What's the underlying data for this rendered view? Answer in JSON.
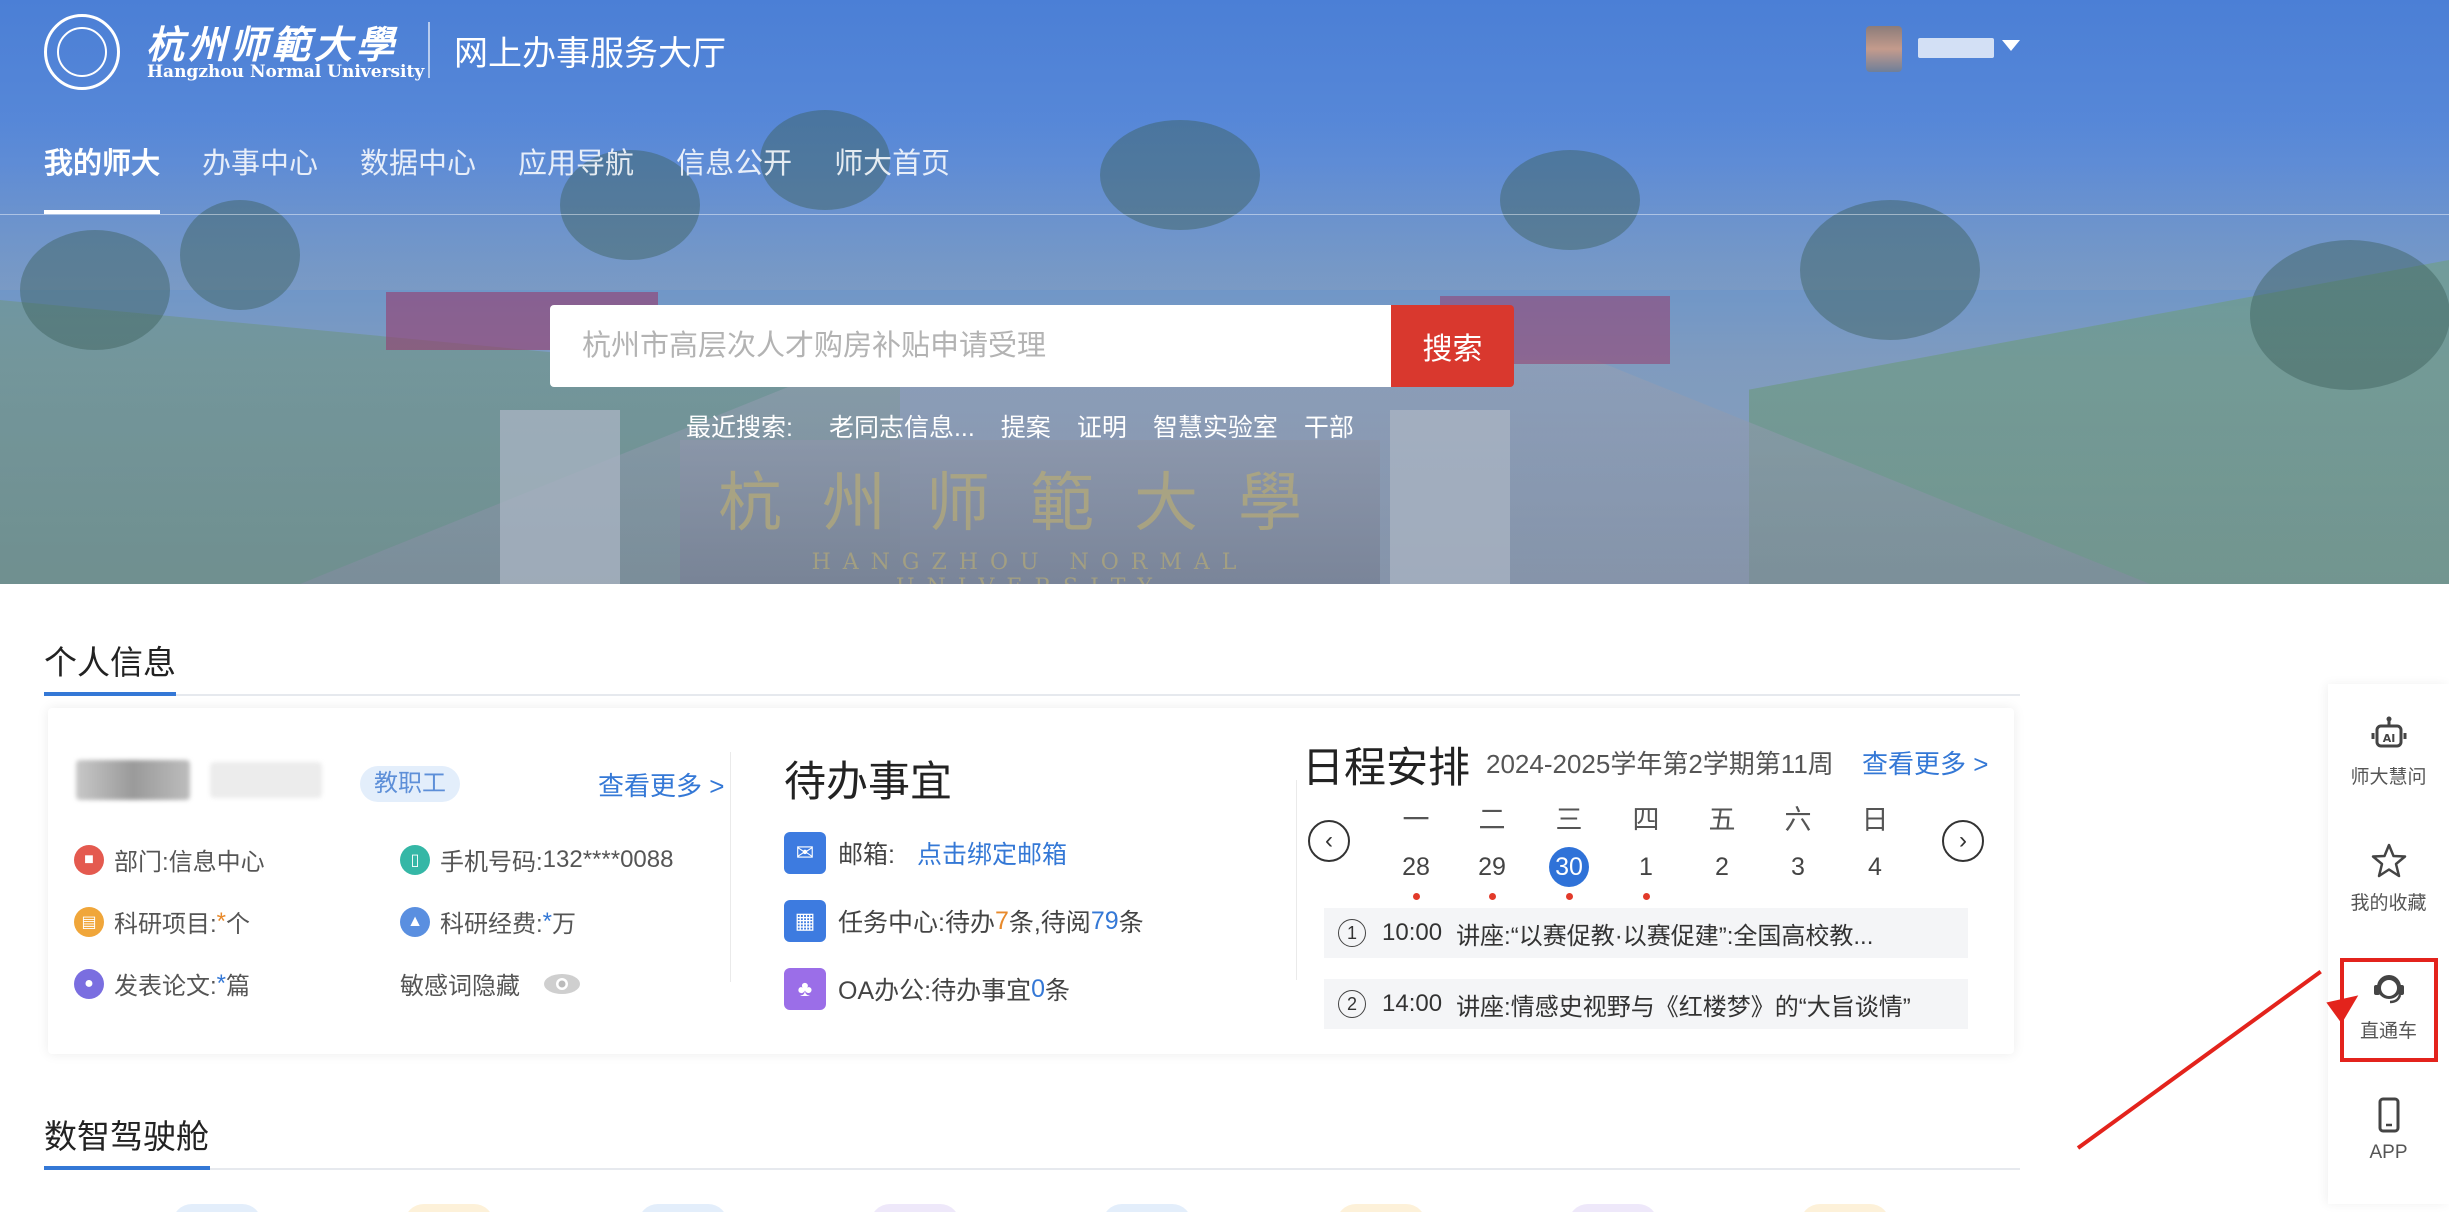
{
  "header": {
    "logo_cn": "杭州师範大學",
    "logo_en": "Hangzhou Normal University",
    "site_title": "网上办事服务大厅"
  },
  "nav": {
    "items": [
      {
        "label": "我的师大",
        "active": true
      },
      {
        "label": "办事中心",
        "active": false
      },
      {
        "label": "数据中心",
        "active": false
      },
      {
        "label": "应用导航",
        "active": false
      },
      {
        "label": "信息公开",
        "active": false
      },
      {
        "label": "师大首页",
        "active": false
      }
    ]
  },
  "hero": {
    "gate_text": "杭州师範大學",
    "gate_sub": "HANGZHOU NORMAL UNIVERSITY"
  },
  "search": {
    "placeholder": "杭州市高层次人才购房补贴申请受理",
    "button_label": "搜索",
    "recent_label": "最近搜索:",
    "recent_tags": [
      "老同志信息...",
      "提案",
      "证明",
      "智慧实验室",
      "干部"
    ]
  },
  "personal": {
    "section_title": "个人信息",
    "role": "教职工",
    "more": "查看更多 >",
    "department_label": "部门:",
    "department_value": "信息中心",
    "phone_label": "手机号码:",
    "phone_value": "132****0088",
    "project_label": "科研项目:",
    "project_value": "*",
    "project_unit": "个",
    "funding_label": "科研经费:",
    "funding_value": "*",
    "funding_unit": "万",
    "paper_label": "发表论文:",
    "paper_value": "*",
    "paper_unit": "篇",
    "sensitive_label": "敏感词隐藏"
  },
  "todo": {
    "title": "待办事宜",
    "mail_label": "邮箱:",
    "mail_link": "点击绑定邮箱",
    "task_prefix": "任务中心:待办",
    "task_pending": "7",
    "task_mid": "条,待阅",
    "task_read": "79",
    "task_suffix": "条",
    "oa_prefix": "OA办公:待办事宜",
    "oa_count": "0",
    "oa_suffix": "条"
  },
  "schedule": {
    "title": "日程安排",
    "term": "2024-2025学年第2学期第11周",
    "more": "查看更多 >",
    "days": [
      {
        "weekday": "一",
        "date": "28",
        "has_event": true,
        "today": false
      },
      {
        "weekday": "二",
        "date": "29",
        "has_event": true,
        "today": false
      },
      {
        "weekday": "三",
        "date": "30",
        "has_event": true,
        "today": true
      },
      {
        "weekday": "四",
        "date": "1",
        "has_event": true,
        "today": false
      },
      {
        "weekday": "五",
        "date": "2",
        "has_event": false,
        "today": false
      },
      {
        "weekday": "六",
        "date": "3",
        "has_event": false,
        "today": false
      },
      {
        "weekday": "日",
        "date": "4",
        "has_event": false,
        "today": false
      }
    ],
    "events": [
      {
        "num": "1",
        "time": "10:00",
        "text": "讲座:“以赛促教·以赛促建”:全国高校教..."
      },
      {
        "num": "2",
        "time": "14:00",
        "text": "讲座:情感史视野与《红楼梦》的“大旨谈情”"
      }
    ]
  },
  "cockpit": {
    "section_title": "数智驾驶舱"
  },
  "sidebar": {
    "items": [
      {
        "label": "师大慧问",
        "icon": "robot-icon"
      },
      {
        "label": "我的收藏",
        "icon": "star-icon"
      },
      {
        "label": "直通车",
        "icon": "headset-icon"
      },
      {
        "label": "APP",
        "icon": "phone-icon"
      }
    ]
  },
  "colors": {
    "accent": "#3478d6",
    "search_button": "#d9382e",
    "highlight": "#e3231c",
    "orange_number": "#e88a2c"
  }
}
